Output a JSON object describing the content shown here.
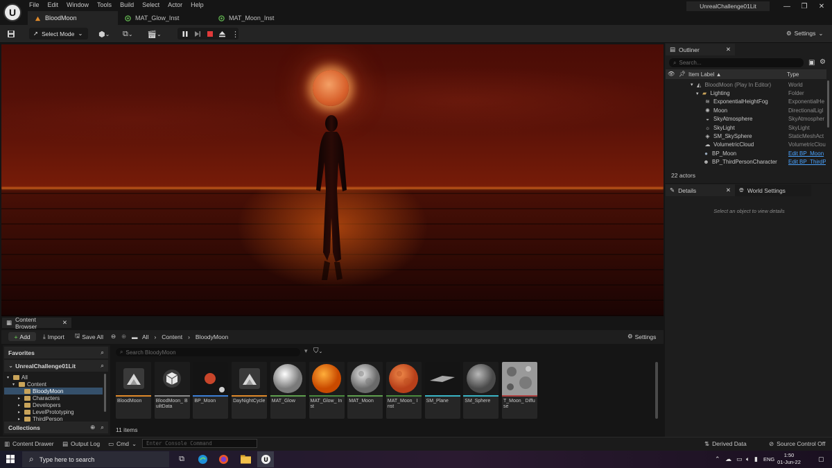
{
  "menu": [
    "File",
    "Edit",
    "Window",
    "Tools",
    "Build",
    "Select",
    "Actor",
    "Help"
  ],
  "tabs": [
    {
      "label": "BloodMoon",
      "active": true
    },
    {
      "label": "MAT_Glow_Inst",
      "active": false
    },
    {
      "label": "MAT_Moon_Inst",
      "active": false
    }
  ],
  "project_name": "UnrealChallenge01Lit",
  "toolbar": {
    "select_mode": "Select Mode",
    "settings": "Settings"
  },
  "outliner": {
    "tab": "Outliner",
    "search_placeholder": "Search...",
    "col_label": "Item Label ▲",
    "col_type": "Type",
    "rows": [
      {
        "label": "BloodMoon (Play In Editor)",
        "type": "World",
        "icon": "world-icon",
        "indent": 0,
        "dim": true
      },
      {
        "label": "Lighting",
        "type": "Folder",
        "icon": "folder-icon",
        "indent": 1
      },
      {
        "label": "ExponentialHeightFog",
        "type": "ExponentialHe",
        "icon": "fog-icon",
        "indent": 2
      },
      {
        "label": "Moon",
        "type": "DirectionalLigl",
        "icon": "directional-light-icon",
        "indent": 2
      },
      {
        "label": "SkyAtmosphere",
        "type": "SkyAtmospher",
        "icon": "sky-atmosphere-icon",
        "indent": 2
      },
      {
        "label": "SkyLight",
        "type": "SkyLight",
        "icon": "sky-light-icon",
        "indent": 2
      },
      {
        "label": "SM_SkySphere",
        "type": "StaticMeshAct",
        "icon": "static-mesh-icon",
        "indent": 2
      },
      {
        "label": "VolumetricCloud",
        "type": "VolumetricClou",
        "icon": "cloud-icon",
        "indent": 2
      },
      {
        "label": "BP_Moon",
        "type": "Edit BP_Moon",
        "icon": "blueprint-icon",
        "indent": 0,
        "link": true
      },
      {
        "label": "BP_ThirdPersonCharacter",
        "type": "Edit BP_ThirdP",
        "icon": "character-icon",
        "indent": 0,
        "link": true
      }
    ],
    "actor_count": "22 actors"
  },
  "details": {
    "tab": "Details",
    "world_tab": "World Settings",
    "hint": "Select an object to view details"
  },
  "content_browser": {
    "tab": "Content Browser",
    "add": "Add",
    "import": "Import",
    "save_all": "Save All",
    "breadcrumb": [
      "All",
      "Content",
      "BloodyMoon"
    ],
    "settings": "Settings",
    "favorites": "Favorites",
    "project": "UnrealChallenge01Lit",
    "tree": [
      {
        "label": "All",
        "indent": 0
      },
      {
        "label": "Content",
        "indent": 1
      },
      {
        "label": "BloodyMoon",
        "indent": 2,
        "selected": true
      },
      {
        "label": "Characters",
        "indent": 2
      },
      {
        "label": "Developers",
        "indent": 2
      },
      {
        "label": "LevelPrototyping",
        "indent": 2
      },
      {
        "label": "ThirdPerson",
        "indent": 2
      }
    ],
    "collections": "Collections",
    "search_placeholder": "Search BloodyMoon",
    "assets": [
      {
        "name": "BloodMoon",
        "kind": "level",
        "bar": "#e08a2a"
      },
      {
        "name": "BloodMoon_ BuiltData",
        "kind": "builtdata",
        "bar": "#8a8a8a"
      },
      {
        "name": "BP_Moon",
        "kind": "blueprint",
        "bar": "#3c7fd6"
      },
      {
        "name": "DayNightCycle",
        "kind": "level",
        "bar": "#e08a2a"
      },
      {
        "name": "MAT_Glow",
        "kind": "material-white",
        "bar": "#5fa04e"
      },
      {
        "name": "MAT_Glow_ Inst",
        "kind": "material-orange",
        "bar": "#4a8a3e"
      },
      {
        "name": "MAT_Moon",
        "kind": "material-moon",
        "bar": "#5fa04e"
      },
      {
        "name": "MAT_Moon_ Inst",
        "kind": "material-moon-orange",
        "bar": "#4a8a3e"
      },
      {
        "name": "SM_Plane",
        "kind": "mesh-plane",
        "bar": "#3ab5c6"
      },
      {
        "name": "SM_Sphere",
        "kind": "mesh-sphere",
        "bar": "#3ab5c6"
      },
      {
        "name": "T_Moon_ Diffuse",
        "kind": "texture",
        "bar": "#b04040"
      }
    ],
    "item_count": "11 items"
  },
  "statusbar": {
    "content_drawer": "Content Drawer",
    "output_log": "Output Log",
    "cmd": "Cmd",
    "console_placeholder": "Enter Console Command",
    "derived_data": "Derived Data",
    "source_control": "Source Control Off"
  },
  "taskbar": {
    "search_placeholder": "Type here to search",
    "lang": "ENG",
    "time": "1:50",
    "date": "01-Jun-22"
  }
}
